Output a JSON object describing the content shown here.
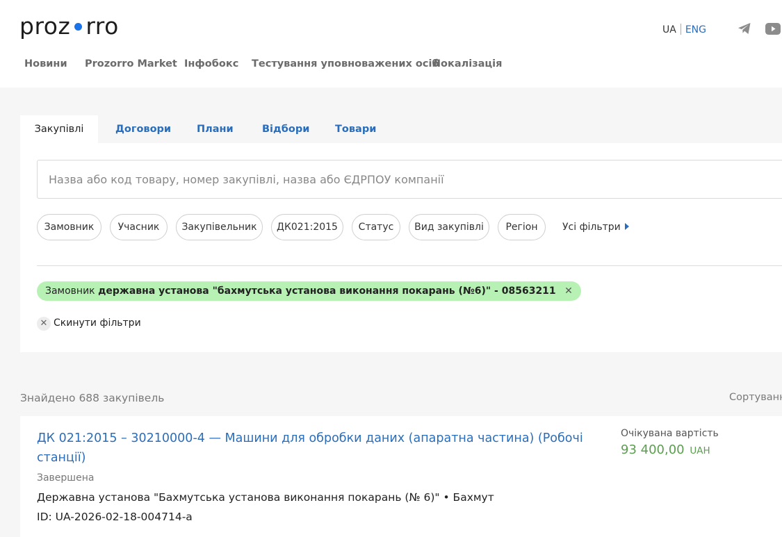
{
  "header": {
    "logo_left": "proz",
    "logo_right": "rro",
    "lang_ua": "UA",
    "lang_eng": "ENG",
    "icons": [
      "telegram-icon",
      "youtube-icon"
    ],
    "nav": [
      "Новини",
      "Prozorro Market",
      "Інфобокс",
      "Тестування уповноважених осіб",
      "Локалізація"
    ]
  },
  "tabs": [
    "Закупівлі",
    "Договори",
    "Плани",
    "Відбори",
    "Товари"
  ],
  "search": {
    "placeholder": "Назва або код товару, номер закупівлі, назва або ЄДРПОУ компанії"
  },
  "filters": {
    "chips": [
      "Замовник",
      "Учасник",
      "Закупівельник",
      "ДК021:2015",
      "Статус",
      "Вид закупівлі",
      "Регіон"
    ],
    "all_filters": "Усі фільтри",
    "active": {
      "label": "Замовник",
      "value": "державна установа \"бахмутська установа виконання покарань (№6)\" - 08563211",
      "remove": "✕"
    },
    "reset": "Скинути фільтри",
    "reset_icon": "✕"
  },
  "results": {
    "found": "Знайдено 688 закупівель",
    "sort": "Сортування"
  },
  "card": {
    "title": "ДК 021:2015 – 30210000-4 — Машини для обробки даних (апаратна частина) (Робочі станції)",
    "status": "Завершена",
    "buyer": "Державна установа \"Бахмутська установа виконання покарань (№ 6)\" • Бахмут",
    "id": "ID: UA-2026-02-18-004714-a",
    "value_label": "Очікувана вартість",
    "value": "93 400,00",
    "currency": "UAH"
  },
  "colors": {
    "accent": "#2a6ebb",
    "logo_dot": "#1a73e8",
    "filter_chip_bg": "#b7f2b4",
    "value_green": "#5b9e4f"
  }
}
